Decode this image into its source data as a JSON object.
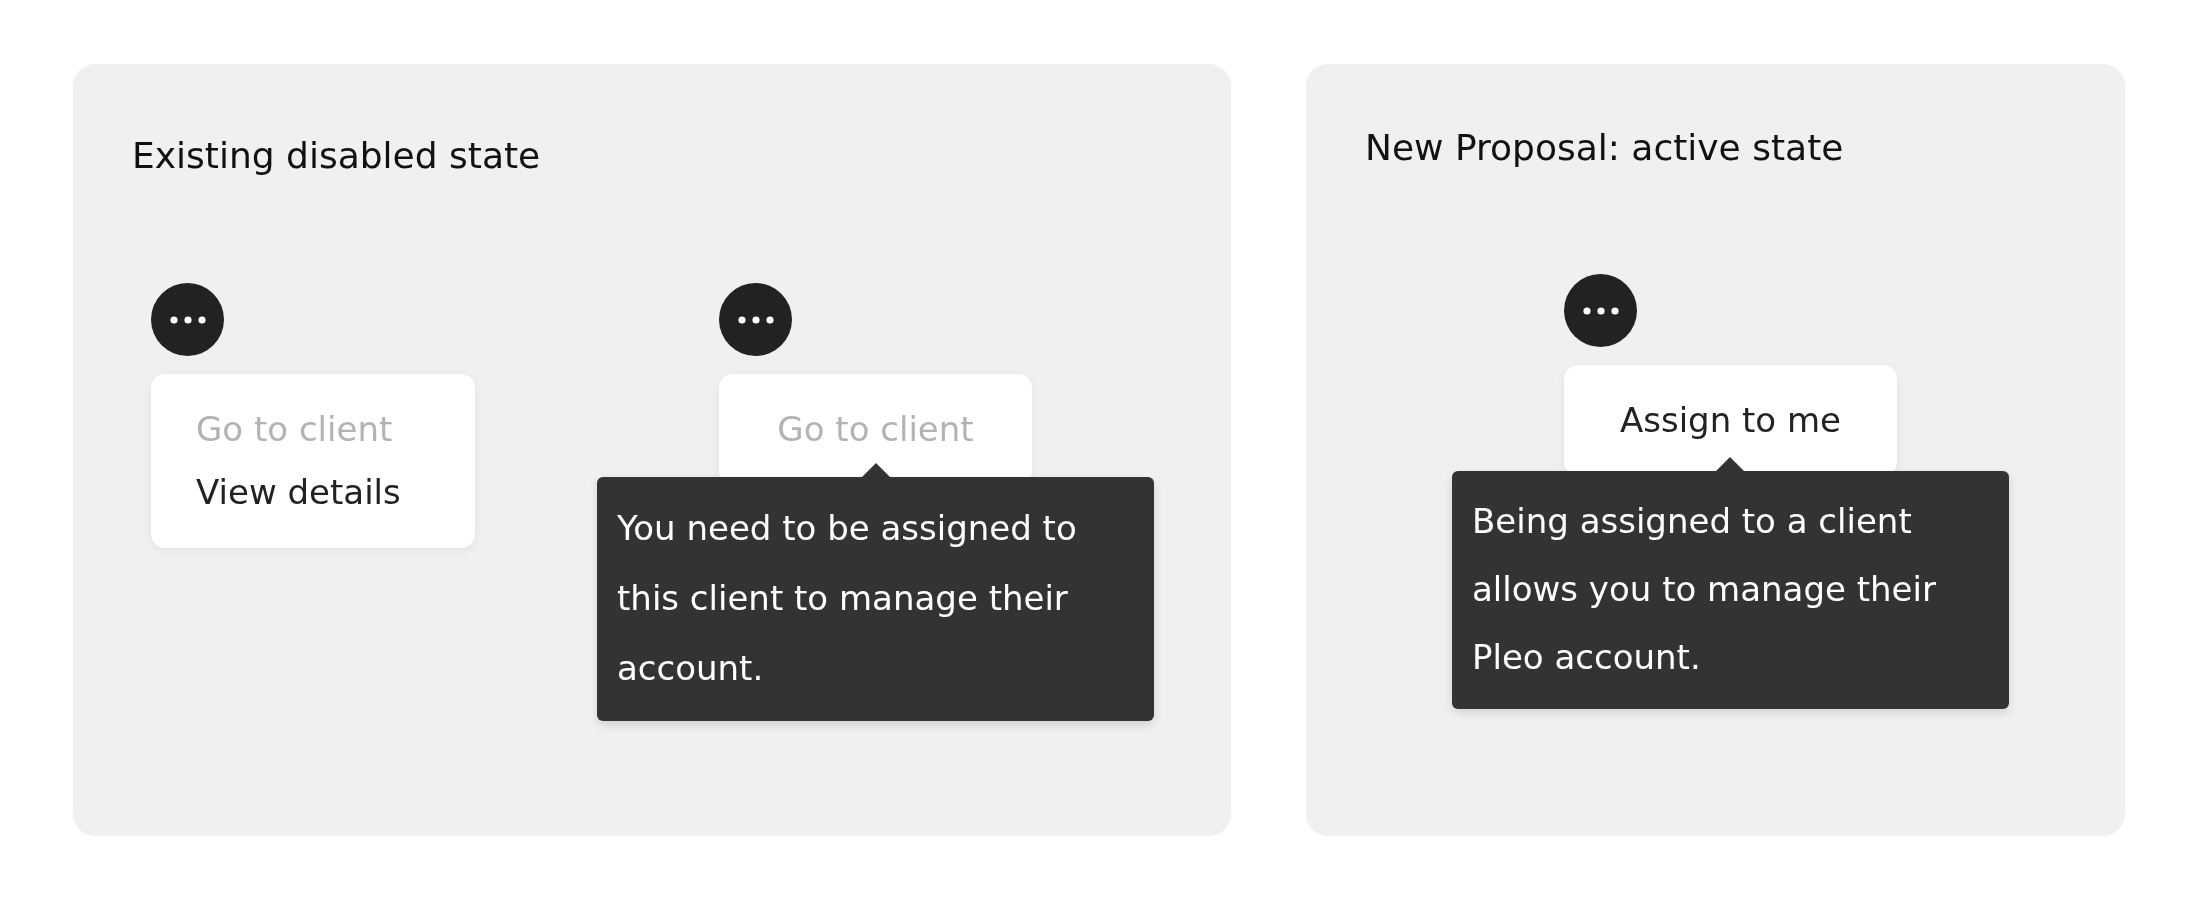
{
  "panels": [
    {
      "title": "Existing disabled state",
      "demos": [
        {
          "menu": [
            {
              "label": "Go to client",
              "disabled": true
            },
            {
              "label": "View details",
              "disabled": false
            }
          ]
        },
        {
          "menu": [
            {
              "label": "Go to client",
              "disabled": true
            }
          ],
          "tooltip": "You need to be assigned to this client to manage their account."
        }
      ]
    },
    {
      "title": "New Proposal: active state",
      "demos": [
        {
          "menu": [
            {
              "label": "Assign to me",
              "disabled": false
            }
          ],
          "tooltip": "Being assigned to a client allows you to manage their Pleo account."
        }
      ]
    }
  ]
}
